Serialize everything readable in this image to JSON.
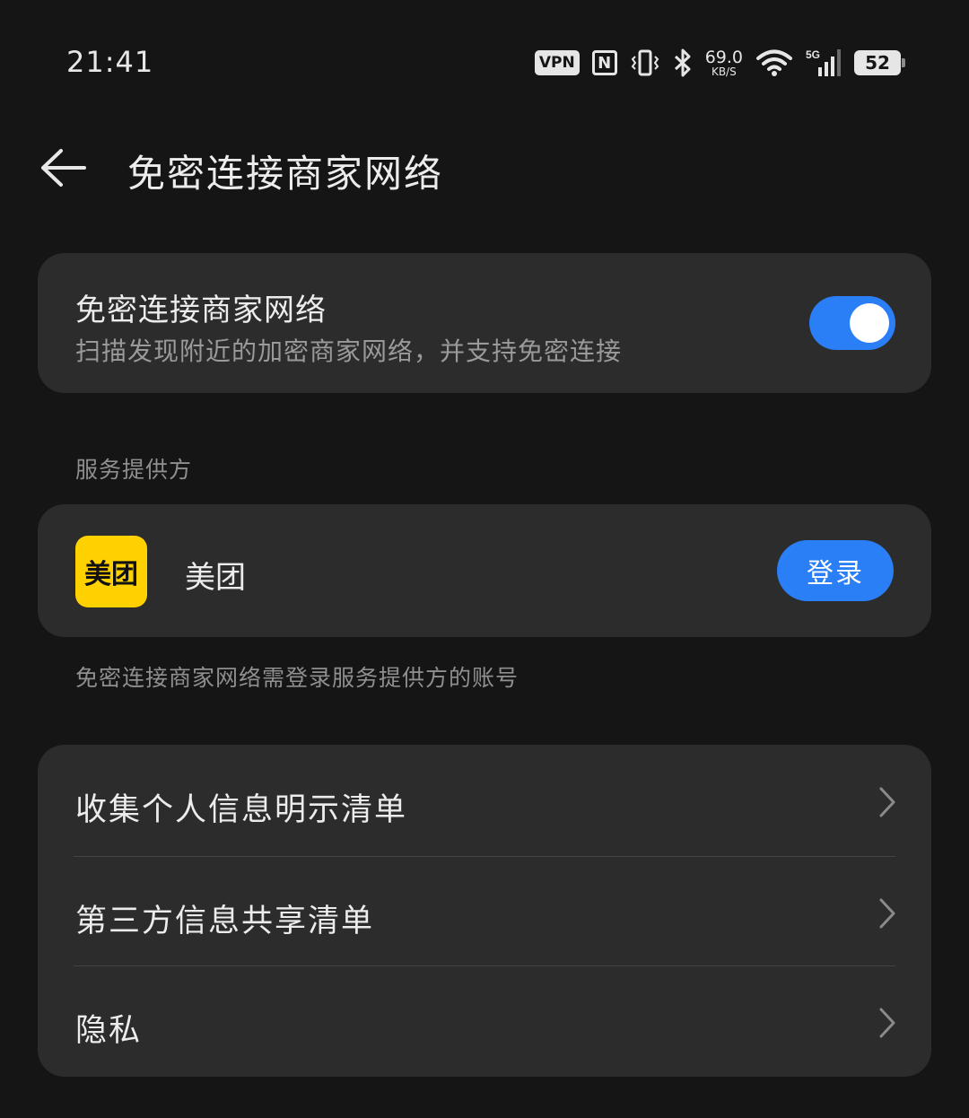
{
  "status_bar": {
    "time": "21:41",
    "vpn": "VPN",
    "nfc": "N",
    "speed_value": "69.0",
    "speed_unit": "KB/S",
    "network": "5G",
    "battery": "52",
    "icons": [
      "vpn-icon",
      "nfc-icon",
      "vibrate-icon",
      "bluetooth-icon",
      "wifi-icon",
      "signal-icon",
      "battery-icon"
    ]
  },
  "header": {
    "back_icon": "arrow-left-icon",
    "title": "免密连接商家网络"
  },
  "toggle_card": {
    "title": "免密连接商家网络",
    "description": "扫描发现附近的加密商家网络，并支持免密连接",
    "enabled": true,
    "accent_color": "#2a7ef6"
  },
  "section": {
    "label": "服务提供方"
  },
  "provider": {
    "logo_text": "美团",
    "name": "美团",
    "login_label": "登录",
    "logo_color": "#ffd100"
  },
  "note": "免密连接商家网络需登录服务提供方的账号",
  "links": [
    {
      "label": "收集个人信息明示清单"
    },
    {
      "label": "第三方信息共享清单"
    },
    {
      "label": "隐私"
    }
  ]
}
